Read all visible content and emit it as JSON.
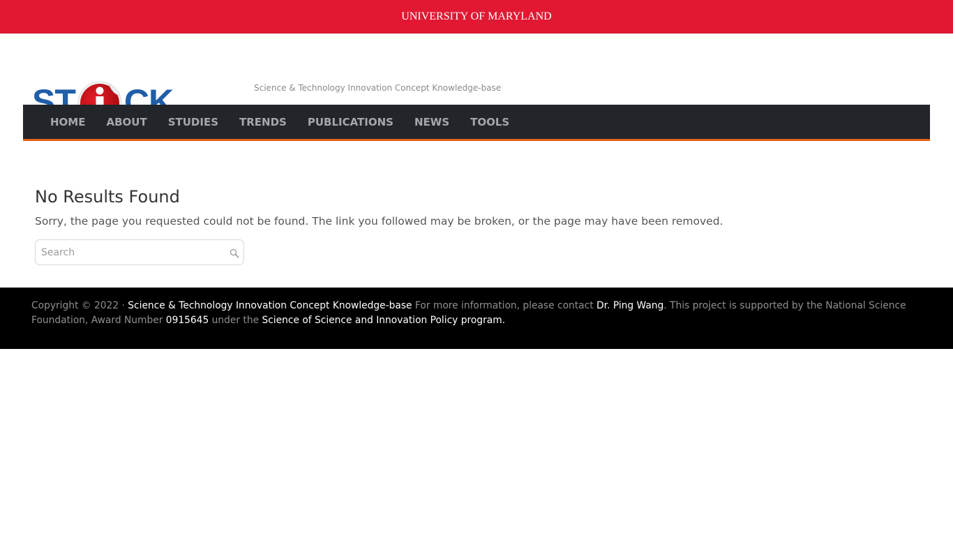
{
  "top_bar": {
    "title": "UNIVERSITY OF MARYLAND",
    "color": "#e21833"
  },
  "header": {
    "logo": {
      "left": "ST",
      "right": "CK",
      "badge_letter": "i",
      "alt": "STICK"
    },
    "tagline": "Science & Technology Innovation Concept Knowledge-base"
  },
  "nav": {
    "items": [
      {
        "label": "HOME"
      },
      {
        "label": "ABOUT"
      },
      {
        "label": "STUDIES"
      },
      {
        "label": "TRENDS"
      },
      {
        "label": "PUBLICATIONS"
      },
      {
        "label": "NEWS"
      },
      {
        "label": "TOOLS"
      }
    ],
    "accent_color": "#e06017"
  },
  "main": {
    "heading": "No Results Found",
    "message": "Sorry, the page you requested could not be found. The link you followed may be broken, or the page may have been removed.",
    "search": {
      "placeholder": "Search",
      "value": ""
    }
  },
  "footer": {
    "copyright": "Copyright © 2022 · ",
    "site_link": "Science & Technology Innovation Concept Knowledge-base",
    "contact_text": " For more information, please contact ",
    "contact_link": "Dr. Ping Wang",
    "support_text": ". This project is supported by the National Science Foundation, Award Number ",
    "award_link": "0915645",
    "under_text": " under the ",
    "program_link": "Science of Science and Innovation Policy program."
  }
}
